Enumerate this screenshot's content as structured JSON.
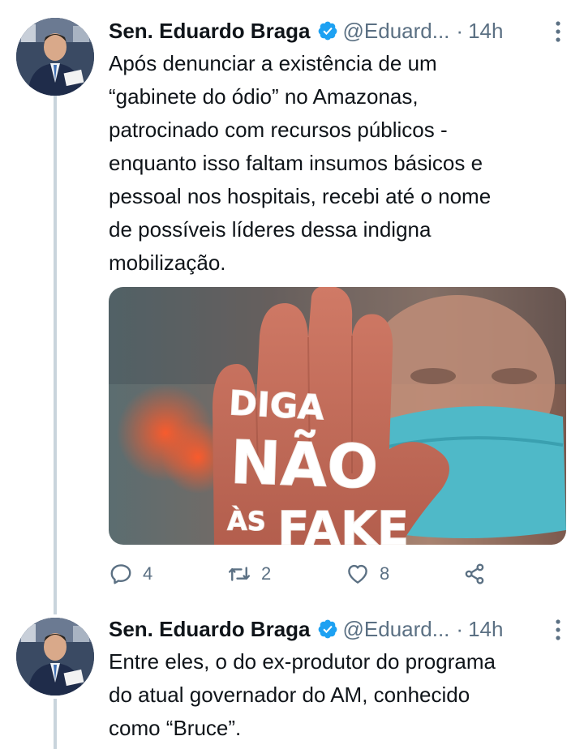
{
  "tweets": [
    {
      "author": {
        "name": "Sen. Eduardo Braga",
        "handle": "@Eduard...",
        "verified": true
      },
      "separator": "·",
      "time": "14h",
      "text": "Após denunciar a existência de um\n“gabinete do ódio” no Amazonas,\npatrocinado com recursos públicos -\nenquanto isso faltam insumos básicos e\npessoal nos hospitais, recebi até o nome\nde possíveis líderes dessa indigna\nmobilização.",
      "media": {
        "overlay_lines": [
          "DIGA",
          "NÃO",
          "ÀS",
          "FAKE"
        ],
        "colors": {
          "mask": "#4fb9c8",
          "hand": "#c96f5e"
        }
      },
      "actions": {
        "reply_count": "4",
        "retweet_count": "2",
        "like_count": "8"
      }
    },
    {
      "author": {
        "name": "Sen. Eduardo Braga",
        "handle": "@Eduard...",
        "verified": true
      },
      "separator": "·",
      "time": "14h",
      "text": "Entre eles, o do ex-produtor do programa\ndo atual governador do AM, conhecido\ncomo “Bruce”."
    }
  ],
  "colors": {
    "verified_blue": "#1da1f2",
    "muted": "#5b7083",
    "thread_line": "#c9d4dc"
  },
  "icons": [
    "verified-badge-icon",
    "more-options-icon",
    "reply-icon",
    "retweet-icon",
    "like-icon",
    "share-icon"
  ]
}
